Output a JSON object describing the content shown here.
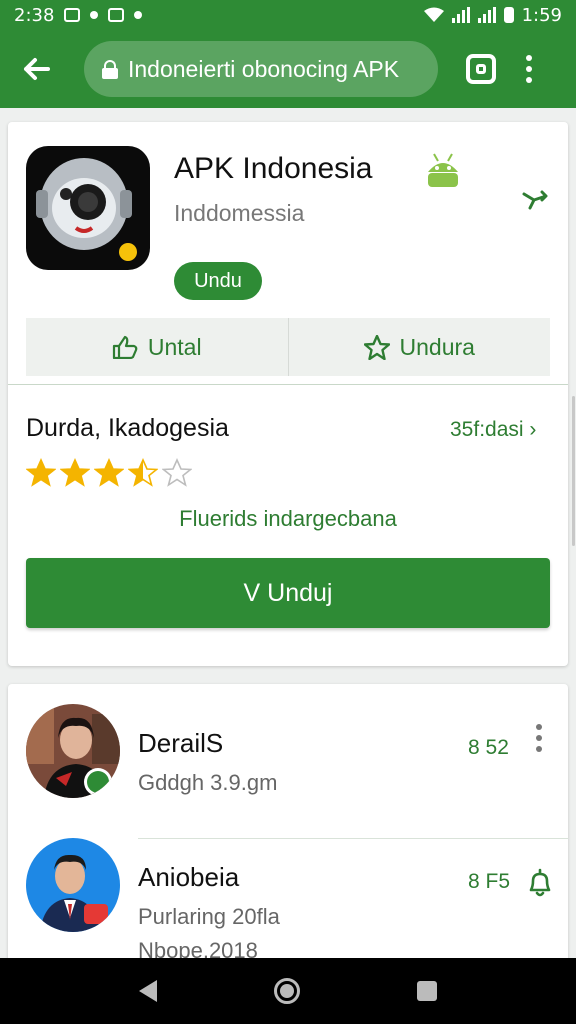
{
  "status_bar": {
    "time": "2:38",
    "battery_text": "1:59"
  },
  "browser": {
    "url_text": "Indoneierti obonocing APK"
  },
  "app_card": {
    "title": "APK Indonesia",
    "subtitle": "Inddomessia",
    "pill_label": "Undu",
    "seg_left_label": "Untal",
    "seg_right_label": "Undura"
  },
  "reviews": {
    "title": "Durda, Ikadogesia",
    "count_text": "35f:dasi",
    "rating": 3.5,
    "max_rating": 5,
    "note": "Fluerids indargecbana"
  },
  "download_button": {
    "label": "V Unduj"
  },
  "list": [
    {
      "title": "DerailS",
      "sub": "Gddgh 3.9.gm",
      "value": "8 52"
    },
    {
      "title": "Aniobeia",
      "sub": "Purlaring 20fla",
      "sub2": "Nbope.2018",
      "value": "8 F5"
    }
  ],
  "colors": {
    "primary": "#2e8b35",
    "accent_text": "#2e7d32",
    "star": "#f4b400"
  }
}
